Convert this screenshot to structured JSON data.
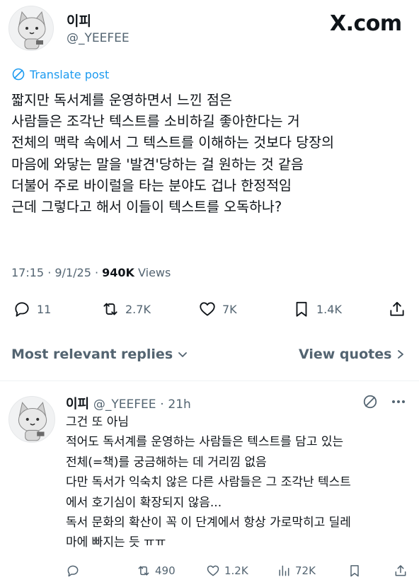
{
  "post": {
    "author_name": "이피",
    "author_handle": "@_YEEFEE",
    "brand": "X.com",
    "translate_label": "Translate post",
    "lines": [
      "짧지만 독서계를 운영하면서 느낀 점은",
      "사람들은 조각난 텍스트를 소비하길 좋아한다는 거",
      "전체의 맥락 속에서 그 텍스트를 이해하는 것보다 당장의",
      "마음에 와닿는 말을 '발견'당하는 걸 원하는 것 같음",
      "더불어 주로 바이럴을 타는 분야도 겁나 한정적임",
      "근데 그렇다고 해서 이들이 텍스트를 오독하나?"
    ],
    "time": "17:15",
    "date": "9/1/25",
    "views_count": "940K",
    "views_label": "Views",
    "actions": {
      "replies": "11",
      "reposts": "2.7K",
      "likes": "7K",
      "bookmarks": "1.4K"
    }
  },
  "replies_bar": {
    "sort_label": "Most relevant replies",
    "quotes_label": "View quotes"
  },
  "reply": {
    "author_name": "이피",
    "author_handle": "@_YEEFEE",
    "age": "21h",
    "lines": [
      "그건 또 아님",
      "적어도 독서계를 운영하는 사람들은 텍스트를 담고 있는",
      "전체(=책)를 궁금해하는 데 거리낌 없음",
      "다만 독서가 익숙치 않은 다른 사람들은 그 조각난 텍스트",
      "에서 호기심이 확장되지 않음...",
      "독서 문화의 확산이 꼭 이 단계에서 항상 가로막히고 딜레",
      "마에 빠지는 듯 ㅠㅠ"
    ],
    "actions": {
      "replies": "",
      "reposts": "490",
      "likes": "1.2K",
      "views": "72K"
    }
  },
  "colors": {
    "accent": "#1d9bf0",
    "secondary_text": "#536471",
    "primary_text": "#0f1419"
  }
}
